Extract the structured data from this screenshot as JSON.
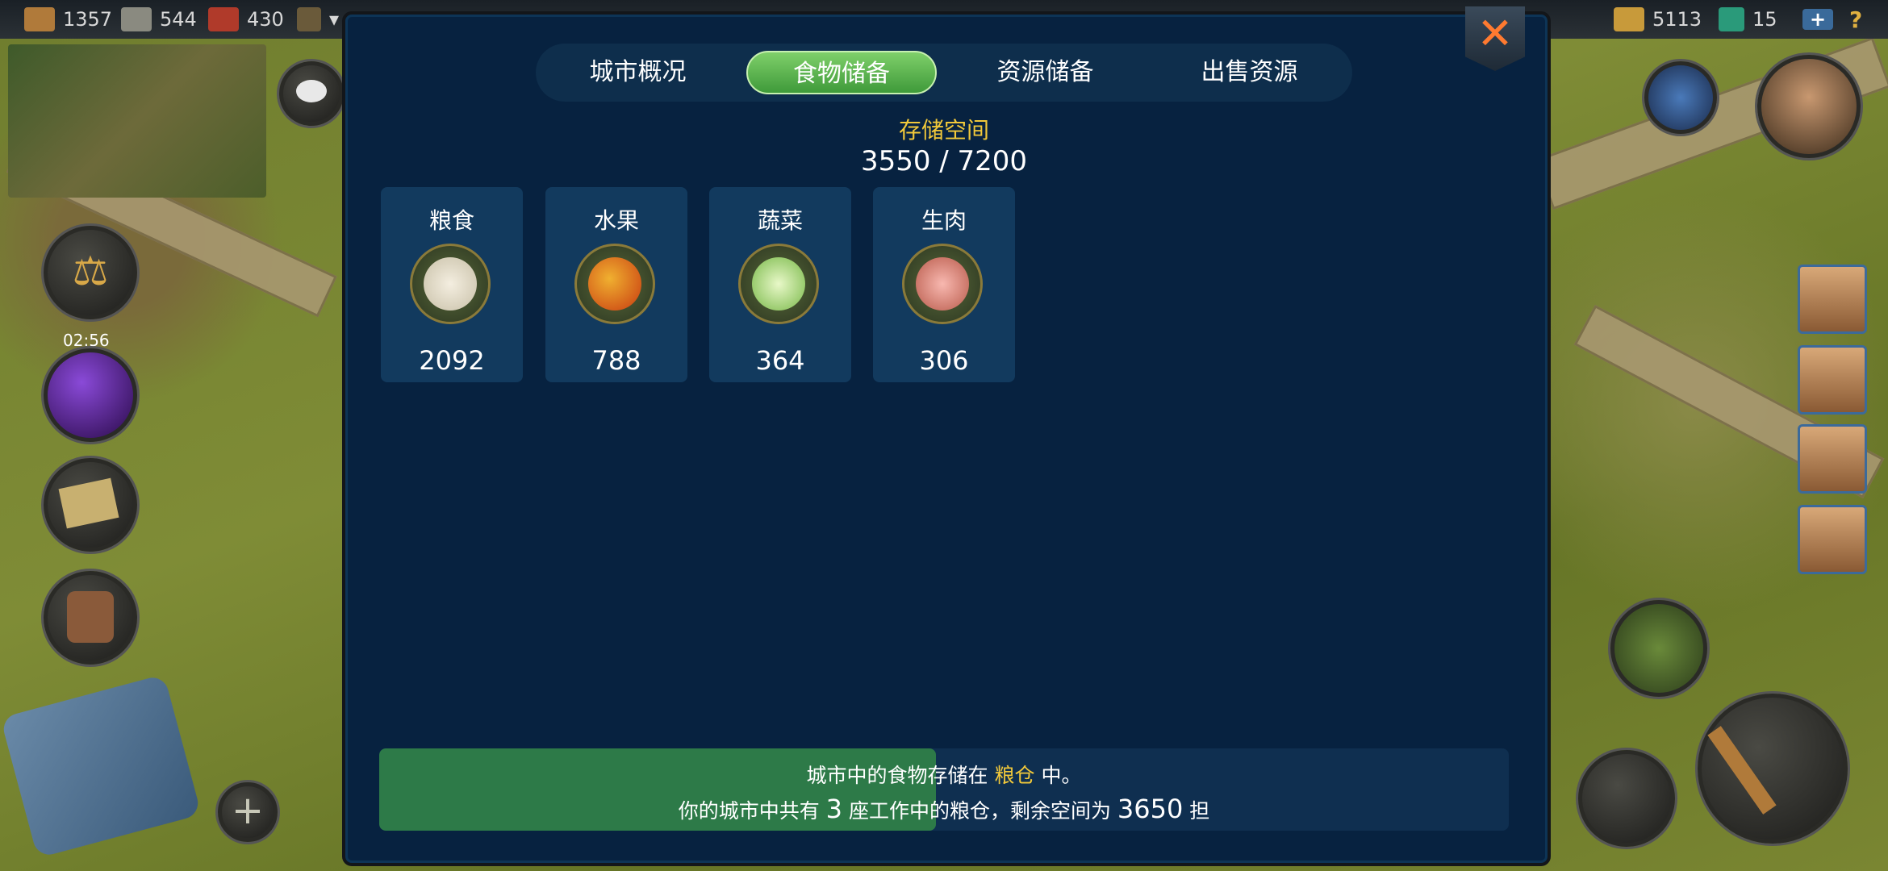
{
  "topbar": {
    "resources": [
      {
        "icon": "wood-icon",
        "value": "1357",
        "color": "#b07a3a"
      },
      {
        "icon": "stone-icon",
        "value": "544",
        "color": "#8a8a80"
      },
      {
        "icon": "brick-icon",
        "value": "430",
        "color": "#b03a2a"
      }
    ],
    "gold": "5113",
    "gems": "15",
    "add_label": "+",
    "help_label": "?"
  },
  "hud": {
    "timer": "02:56",
    "add_label": "+"
  },
  "tabs": [
    {
      "label": "城市概况",
      "active": false
    },
    {
      "label": "食物储备",
      "active": true
    },
    {
      "label": "资源储备",
      "active": false
    },
    {
      "label": "出售资源",
      "active": false
    }
  ],
  "close_label": "✕",
  "storage": {
    "title": "存储空间",
    "value": "3550 / 7200",
    "used": 3550,
    "capacity": 7200
  },
  "foods": [
    {
      "name": "粮食",
      "value": "2092",
      "icon": "grain-sack-icon",
      "color": "#e8e0c8"
    },
    {
      "name": "水果",
      "value": "788",
      "icon": "apple-icon",
      "color": "#e06a1a"
    },
    {
      "name": "蔬菜",
      "value": "364",
      "icon": "cabbage-icon",
      "color": "#a8d878"
    },
    {
      "name": "生肉",
      "value": "306",
      "icon": "meat-icon",
      "color": "#e08a80"
    }
  ],
  "info": {
    "line1_prefix": "城市中的食物存储在 ",
    "line1_highlight": "粮仓",
    "line1_suffix": " 中。",
    "line2_prefix": "你的城市中共有 ",
    "line2_count": "3",
    "line2_middle": " 座工作中的粮仓，剩余空间为 ",
    "line2_space": "3650",
    "line2_unit": " 担",
    "fill_fraction": 0.493
  }
}
